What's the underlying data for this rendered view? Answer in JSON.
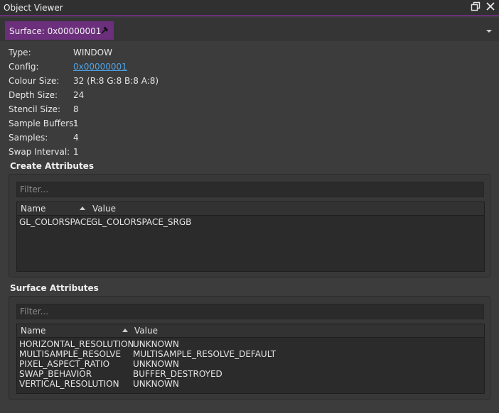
{
  "window": {
    "title": "Object Viewer",
    "restore_icon": "restore-icon",
    "close_icon": "close-icon"
  },
  "tab": {
    "label": "Surface: 0x00000001",
    "close_icon": "unpin-icon"
  },
  "properties": [
    {
      "key": "Type:",
      "value": "WINDOW"
    },
    {
      "key": "Config:",
      "value": "0x00000001"
    },
    {
      "key": "Colour Size:",
      "value": "32 (R:8 G:8 B:8 A:8)"
    },
    {
      "key": "Depth Size:",
      "value": "24"
    },
    {
      "key": "Stencil Size:",
      "value": "8"
    },
    {
      "key": "Sample Buffers:",
      "value": "1"
    },
    {
      "key": "Samples:",
      "value": "4"
    },
    {
      "key": "Swap Interval:",
      "value": "1"
    }
  ],
  "create_attributes": {
    "title": "Create Attributes",
    "filter_placeholder": "Filter...",
    "columns": [
      "Name",
      "Value"
    ],
    "rows": [
      [
        "GL_COLORSPACE",
        "GL_COLORSPACE_SRGB"
      ]
    ]
  },
  "surface_attributes": {
    "title": "Surface Attributes",
    "filter_placeholder": "Filter...",
    "columns": [
      "Name",
      "Value"
    ],
    "rows": [
      [
        "HORIZONTAL_RESOLUTION",
        "UNKNOWN"
      ],
      [
        "MULTISAMPLE_RESOLVE",
        "MULTISAMPLE_RESOLVE_DEFAULT"
      ],
      [
        "PIXEL_ASPECT_RATIO",
        "UNKNOWN"
      ],
      [
        "SWAP_BEHAVIOR",
        "BUFFER_DESTROYED"
      ],
      [
        "VERTICAL_RESOLUTION",
        "UNKNOWN"
      ]
    ]
  },
  "colors": {
    "accent": "#6b2f7b",
    "link": "#4ea3e8"
  }
}
